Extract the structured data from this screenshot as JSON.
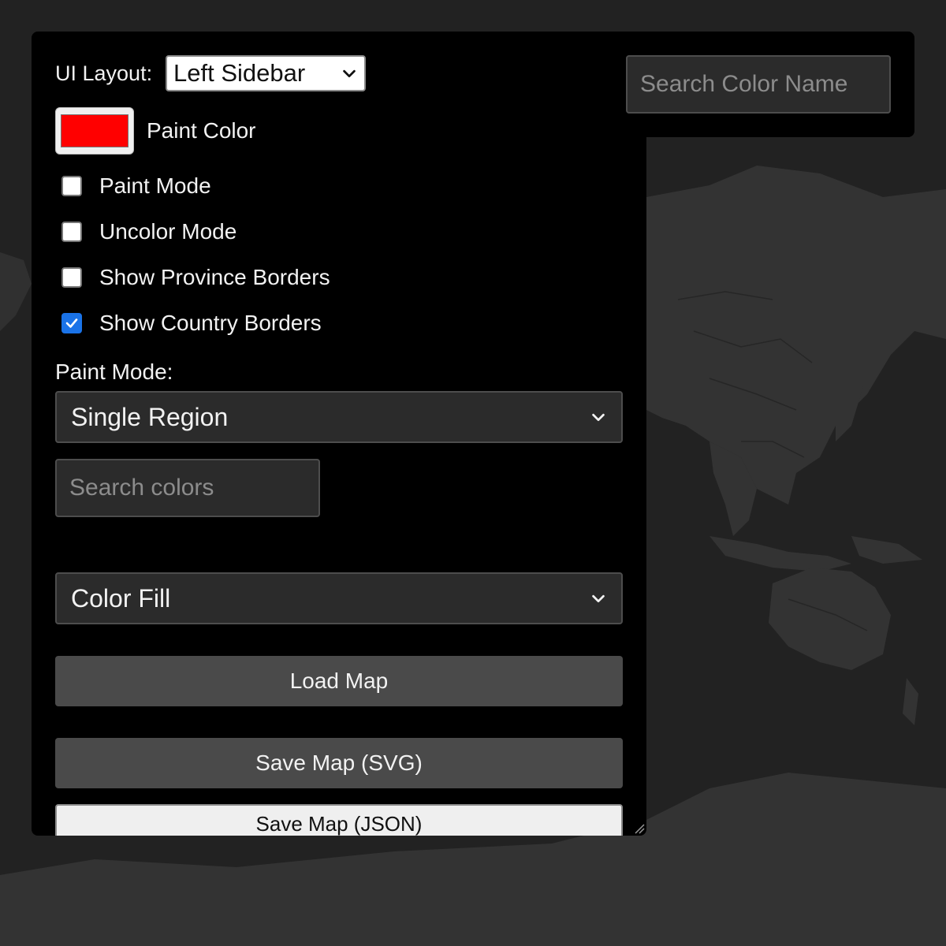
{
  "layout": {
    "label": "UI Layout:",
    "selected": "Left Sidebar"
  },
  "paint_color": {
    "label": "Paint Color",
    "value": "#ff0000"
  },
  "checkboxes": [
    {
      "label": "Paint Mode",
      "checked": false
    },
    {
      "label": "Uncolor Mode",
      "checked": false
    },
    {
      "label": "Show Province Borders",
      "checked": false
    },
    {
      "label": "Show Country Borders",
      "checked": true
    }
  ],
  "paint_mode": {
    "label": "Paint Mode:",
    "selected": "Single Region"
  },
  "search_colors": {
    "placeholder": "Search colors"
  },
  "fill_mode": {
    "selected": "Color Fill"
  },
  "buttons": {
    "load": "Load Map",
    "save_svg": "Save Map (SVG)",
    "save_json": "Save Map (JSON)"
  },
  "color_name_search": {
    "placeholder": "Search Color Name"
  },
  "colors": {
    "background": "#222222",
    "panel": "#000000",
    "land": "#2e2e2e",
    "accent_checkbox": "#1a73e8",
    "paint_swatch": "#ff0000"
  }
}
